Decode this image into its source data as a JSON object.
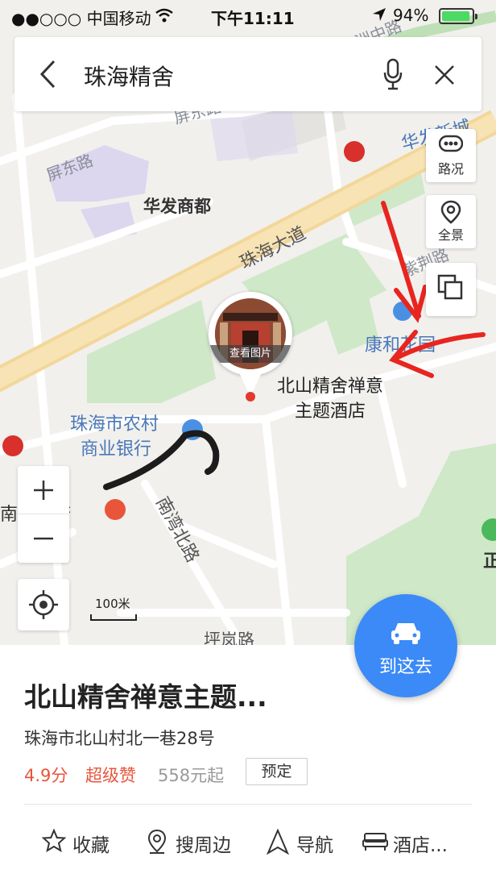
{
  "status_bar": {
    "carrier": "●●○○○ 中国移动",
    "time": "下午11:11",
    "battery": "94%"
  },
  "search": {
    "query": "珠海精舍"
  },
  "map": {
    "road_labels": [
      "屏东路",
      "屏东路",
      "珠海大道",
      "南湾北路",
      "坪岚路",
      "紫荆路"
    ],
    "poi_labels": {
      "mall": "华发商都",
      "huafa": "华发新城",
      "kanghe": "康和花园",
      "bank_line1": "珠海市农村",
      "bank_line2": "商业银行",
      "gov": "南屏政府",
      "top_road": "香洲中路",
      "green_poi": "正"
    },
    "hotel_label_line1": "北山精舍禅意",
    "hotel_label_line2": "主题酒店",
    "pin_caption": "查看图片",
    "scale": "100米"
  },
  "controls": {
    "traffic": "路况",
    "panorama": "全景",
    "go": "到这去"
  },
  "place": {
    "title": "北山精舍禅意主题...",
    "address": "珠海市北山村北一巷28号",
    "rating": "4.9分",
    "praise": "超级赞",
    "price": "558元起",
    "book": "预定"
  },
  "actions": {
    "favorite": "收藏",
    "nearby": "搜周边",
    "navigate": "导航",
    "hotel": "酒店..."
  },
  "colors": {
    "accent": "#3b8af7",
    "rating": "#e8553b",
    "annotation": "#e8251f"
  }
}
